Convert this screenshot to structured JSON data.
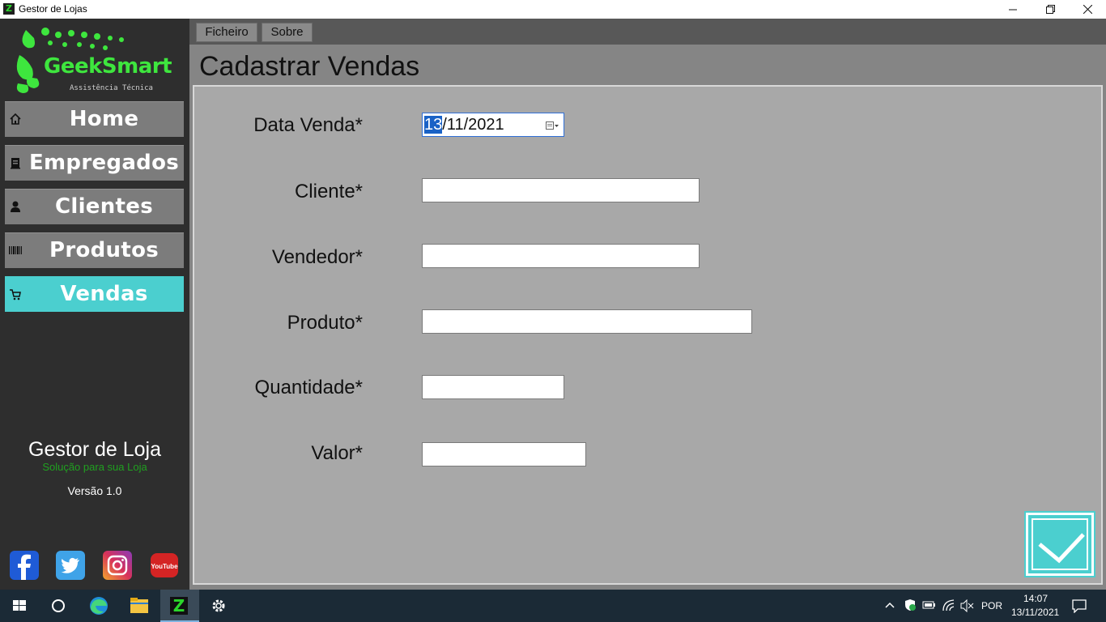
{
  "window": {
    "title": "Gestor de Lojas",
    "controls": [
      "minimize-icon",
      "restore-icon",
      "close-icon"
    ]
  },
  "logo": {
    "text_geek": "Geek",
    "text_smart": "Smart",
    "tagline": "Assistência Técnica",
    "color": "#3ee63e"
  },
  "sidebar": {
    "items": [
      {
        "label": "Home",
        "icon": "home-icon",
        "active": false
      },
      {
        "label": "Empregados",
        "icon": "badge-icon",
        "active": false
      },
      {
        "label": "Clientes",
        "icon": "user-icon",
        "active": false
      },
      {
        "label": "Produtos",
        "icon": "barcode-icon",
        "active": false
      },
      {
        "label": "Vendas",
        "icon": "cart-icon",
        "active": true
      }
    ],
    "app_name": "Gestor de Loja",
    "app_tagline": "Solução para sua Loja",
    "version": "Versão 1.0",
    "social": [
      "facebook-icon",
      "twitter-icon",
      "instagram-icon",
      "youtube-icon"
    ],
    "youtube_text": "YouTube",
    "active_color": "#4bcfcf"
  },
  "menu": {
    "items": [
      "Ficheiro",
      "Sobre"
    ]
  },
  "page": {
    "title": "Cadastrar Vendas"
  },
  "form": {
    "date_label": "Data Venda*",
    "date_value_selected": "13",
    "date_value_rest": "/11/2021",
    "cliente_label": "Cliente*",
    "cliente_value": "",
    "vendedor_label": "Vendedor*",
    "vendedor_value": "",
    "produto_label": "Produto*",
    "produto_value": "",
    "quantidade_label": "Quantidade*",
    "quantidade_value": "",
    "valor_label": "Valor*",
    "valor_value": ""
  },
  "confirm": {
    "icon": "checkmark-icon"
  },
  "taskbar": {
    "pinned": [
      "windows-start-icon",
      "search-circle-icon",
      "edge-icon",
      "file-explorer-icon",
      "geeksmart-app-icon",
      "settings-gear-icon"
    ],
    "tray_icons": [
      "chevron-up-icon",
      "security-shield-icon",
      "battery-icon",
      "wifi-icon",
      "volume-muted-icon"
    ],
    "language": "POR",
    "time": "14:07",
    "date": "13/11/2021",
    "notification_icon": "notification-icon"
  }
}
